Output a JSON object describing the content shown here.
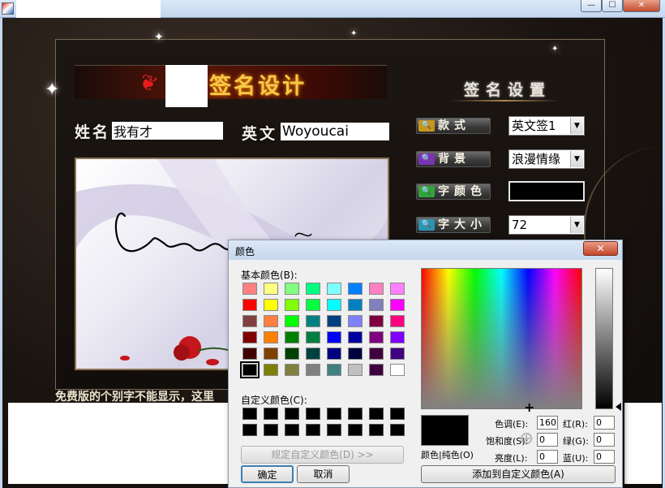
{
  "window": {
    "close_glyph": "✕",
    "min_glyph": "—",
    "max_glyph": "☐"
  },
  "app": {
    "title": "签名设计",
    "settings_title": "签名设置",
    "name_label": "姓名",
    "name_value": "我有才",
    "english_label": "英文",
    "english_value": "Woyoucai",
    "signature_text": "Woyoucai",
    "footer_note": "免费版的个别字不能显示，这里"
  },
  "settings": {
    "style_label": "款式",
    "style_value": "英文签1",
    "background_label": "背景",
    "background_value": "浪漫情缘",
    "color_label": "字颜色",
    "size_label": "字大小",
    "size_value": "72",
    "dropdown_arrow": "▼",
    "icon_glyph": "🔍"
  },
  "colors": {
    "current_font_color": "#000000",
    "accent_gold": "#f5c94a"
  },
  "color_dialog": {
    "title": "颜色",
    "close_glyph": "✕",
    "basic_colors_label": "基本颜色(B):",
    "custom_colors_label": "自定义颜色(C):",
    "define_custom_button": "规定自定义颜色(D) >>",
    "ok_button": "确定",
    "cancel_button": "取消",
    "add_custom_button": "添加到自定义颜色(A)",
    "solid_color_label": "颜色|纯色(O)",
    "hue_label": "色调(E):",
    "hue_value": "160",
    "saturation_label": "饱和度(S):",
    "saturation_value": "0",
    "luminance_label": "亮度(L):",
    "luminance_value": "0",
    "red_label": "红(R):",
    "red_value": "0",
    "green_label": "绿(G):",
    "green_value": "0",
    "blue_label": "蓝(U):",
    "blue_value": "0",
    "basic_colors": [
      "#ff8080",
      "#ffff80",
      "#80ff80",
      "#00ff80",
      "#80ffff",
      "#0080ff",
      "#ff80c0",
      "#ff80ff",
      "#ff0000",
      "#ffff00",
      "#80ff00",
      "#00ff40",
      "#00ffff",
      "#0080c0",
      "#8080c0",
      "#ff00ff",
      "#804040",
      "#ff8040",
      "#00ff00",
      "#008080",
      "#004080",
      "#8080ff",
      "#800040",
      "#ff0080",
      "#800000",
      "#ff8000",
      "#008000",
      "#008040",
      "#0000ff",
      "#0000a0",
      "#800080",
      "#8000ff",
      "#400000",
      "#804000",
      "#004000",
      "#004040",
      "#000080",
      "#000040",
      "#400040",
      "#400080",
      "#000000",
      "#808000",
      "#808040",
      "#808080",
      "#408080",
      "#c0c0c0",
      "#400040",
      "#ffffff"
    ]
  }
}
